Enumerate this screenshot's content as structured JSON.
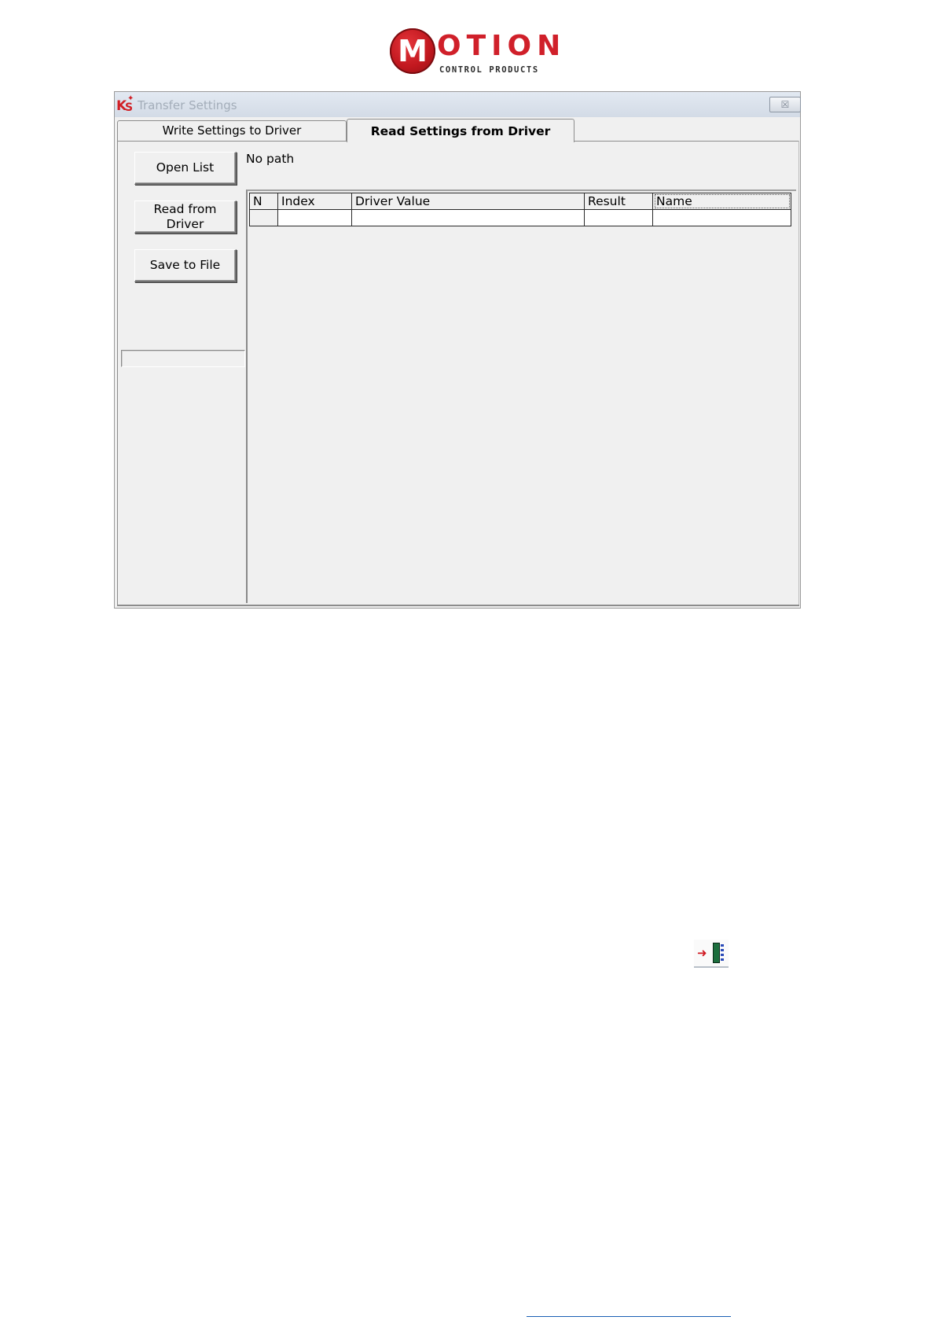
{
  "logo": {
    "letter": "M",
    "word": "OTION",
    "subtitle": "CONTROL PRODUCTS",
    "brand_color": "#d0202a"
  },
  "window": {
    "app_icon": "ks-app-icon",
    "app_icon_text_k": "K",
    "app_icon_text_s": "S",
    "title": "Transfer Settings",
    "close_glyph": "☒"
  },
  "tabs": [
    {
      "label": "Write Settings to Driver",
      "active": false
    },
    {
      "label": "Read Settings from Driver",
      "active": true
    }
  ],
  "buttons": {
    "open_list": "Open List",
    "read_from_driver": "Read from\nDriver",
    "save_to_file": "Save to File"
  },
  "path": "No path",
  "grid": {
    "columns": [
      "N",
      "Index",
      "Driver Value",
      "Result",
      "Name"
    ],
    "rows": [
      [
        "",
        "",
        "",
        "",
        ""
      ]
    ]
  },
  "toolbar_icon": {
    "name": "transfer-settings-icon",
    "arrow_glyph": "➜"
  }
}
